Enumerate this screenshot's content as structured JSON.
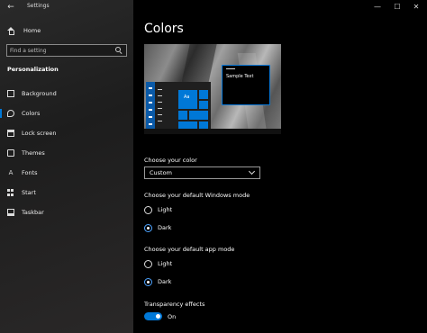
{
  "window": {
    "title": "Settings",
    "back_glyph": "←",
    "minimize_glyph": "—",
    "maximize_glyph": "☐",
    "close_glyph": "✕"
  },
  "sidebar": {
    "home_label": "Home",
    "search_placeholder": "Find a setting",
    "section_title": "Personalization",
    "items": [
      {
        "label": "Background",
        "icon": "image-icon",
        "selected": false
      },
      {
        "label": "Colors",
        "icon": "palette-icon",
        "selected": true
      },
      {
        "label": "Lock screen",
        "icon": "lock-screen-icon",
        "selected": false
      },
      {
        "label": "Themes",
        "icon": "brush-icon",
        "selected": false
      },
      {
        "label": "Fonts",
        "icon": "font-icon",
        "selected": false
      },
      {
        "label": "Start",
        "icon": "start-grid-icon",
        "selected": false
      },
      {
        "label": "Taskbar",
        "icon": "taskbar-icon",
        "selected": false
      }
    ],
    "fonts_glyph": "A"
  },
  "main": {
    "title": "Colors",
    "preview": {
      "tile_label": "Aa",
      "sample_text": "Sample Text"
    },
    "choose_color_label": "Choose your color",
    "choose_color_value": "Custom",
    "windows_mode_label": "Choose your default Windows mode",
    "windows_mode_options": [
      "Light",
      "Dark"
    ],
    "windows_mode_selected": "Dark",
    "app_mode_label": "Choose your default app mode",
    "app_mode_options": [
      "Light",
      "Dark"
    ],
    "app_mode_selected": "Dark",
    "transparency_label": "Transparency effects",
    "transparency_state": "On"
  },
  "colors": {
    "accent": "#0078d7",
    "sidebar_bg": "#1d1d1d",
    "main_bg": "#000000"
  }
}
